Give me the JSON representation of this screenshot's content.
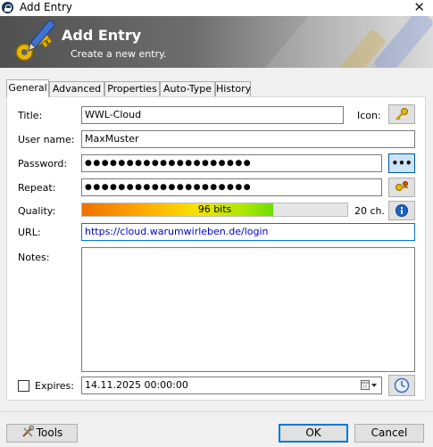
{
  "window": {
    "title": "Add Entry",
    "close_glyph": "✕"
  },
  "banner": {
    "title": "Add Entry",
    "subtitle": "Create a new entry."
  },
  "tabs": [
    {
      "label": "General",
      "active": true
    },
    {
      "label": "Advanced",
      "active": false
    },
    {
      "label": "Properties",
      "active": false
    },
    {
      "label": "Auto-Type",
      "active": false
    },
    {
      "label": "History",
      "active": false
    }
  ],
  "form": {
    "title_label": "Title:",
    "title_value": "WWL-Cloud",
    "icon_label": "Icon:",
    "username_label": "User name:",
    "username_value": "MaxMuster",
    "password_label": "Password:",
    "password_value": "●●●●●●●●●●●●●●●●●●●●",
    "password_toggle_glyph": "•••",
    "repeat_label": "Repeat:",
    "repeat_value": "●●●●●●●●●●●●●●●●●●●●",
    "quality_label": "Quality:",
    "quality_text": "96 bits",
    "quality_fraction": 0.72,
    "char_count": "20 ch.",
    "url_label": "URL:",
    "url_value": "https://cloud.warumwirleben.de/login",
    "notes_label": "Notes:",
    "notes_value": "",
    "expires_label": "Expires:",
    "expires_checked": false,
    "expires_value": "14.11.2025 00:00:00"
  },
  "footer": {
    "tools_label": "Tools",
    "ok_label": "OK",
    "cancel_label": "Cancel"
  },
  "colors": {
    "accent": "#0078d7",
    "banner_dark": "#505050",
    "url_text": "#0000cc"
  }
}
